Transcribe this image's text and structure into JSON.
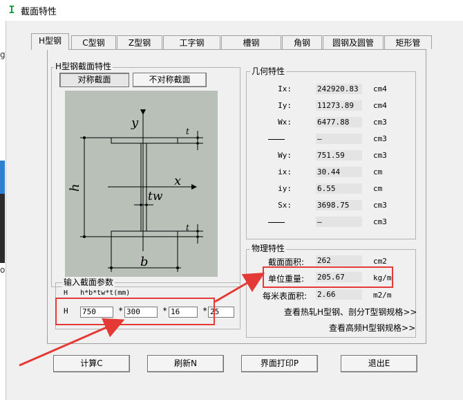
{
  "window": {
    "title": "截面特性",
    "app_icon": "I"
  },
  "edge_text": {
    "g": "g",
    "o": "o"
  },
  "tabs": [
    "H型钢",
    "C型钢",
    "Z型钢",
    "工字钢",
    "槽钢",
    "角钢",
    "圆钢及圆管",
    "矩形管"
  ],
  "section_group": {
    "label": "H型钢截面特性",
    "symmetric_button": "对称截面",
    "asymmetric_button": "不对称截面"
  },
  "diagram_labels": {
    "y": "y",
    "x": "x",
    "h": "h",
    "b": "b",
    "t1": "t",
    "t2": "t",
    "tw": "tw"
  },
  "geometry": {
    "label": "几何特性",
    "rows": [
      {
        "name": "Ix:",
        "value": "242920.83",
        "unit": "cm4"
      },
      {
        "name": "Iy:",
        "value": "11273.89",
        "unit": "cm4"
      },
      {
        "name": "Wx:",
        "value": "6477.88",
        "unit": "cm3"
      },
      {
        "name": "",
        "value": "—",
        "unit": "cm3"
      },
      {
        "name": "Wy:",
        "value": "751.59",
        "unit": "cm3"
      },
      {
        "name": "ix:",
        "value": "30.44",
        "unit": "cm"
      },
      {
        "name": "iy:",
        "value": "6.55",
        "unit": "cm"
      },
      {
        "name": "Sx:",
        "value": "3698.75",
        "unit": "cm3"
      },
      {
        "name": "",
        "value": "—",
        "unit": "cm3"
      }
    ]
  },
  "physical": {
    "label": "物理特性",
    "area_label": "截面面积:",
    "area_value": "262",
    "area_unit": "cm2",
    "weight_label": "单位重量:",
    "weight_value": "205.67",
    "weight_unit": "kg/m",
    "surface_label": "每米表面积:",
    "surface_value": "2.66",
    "surface_unit": "m2/m",
    "link_hot_rolled": "查看热轧H型钢、剖分T型钢规格>>",
    "link_high_freq": "查看高频H型钢规格>>"
  },
  "input_group": {
    "label": "输入截面参数",
    "format_label": "H   h*b*tw*t(mm)",
    "prefix": "H",
    "h": "750",
    "b": "300",
    "tw": "16",
    "t": "25",
    "star": "*"
  },
  "buttons": {
    "calculate": "计算C",
    "refresh": "刷新N",
    "print": "界面打印P",
    "exit": "退出E"
  },
  "colors": {
    "annotation_red": "#e53935",
    "diagram_bg": "#b8c0b8"
  }
}
